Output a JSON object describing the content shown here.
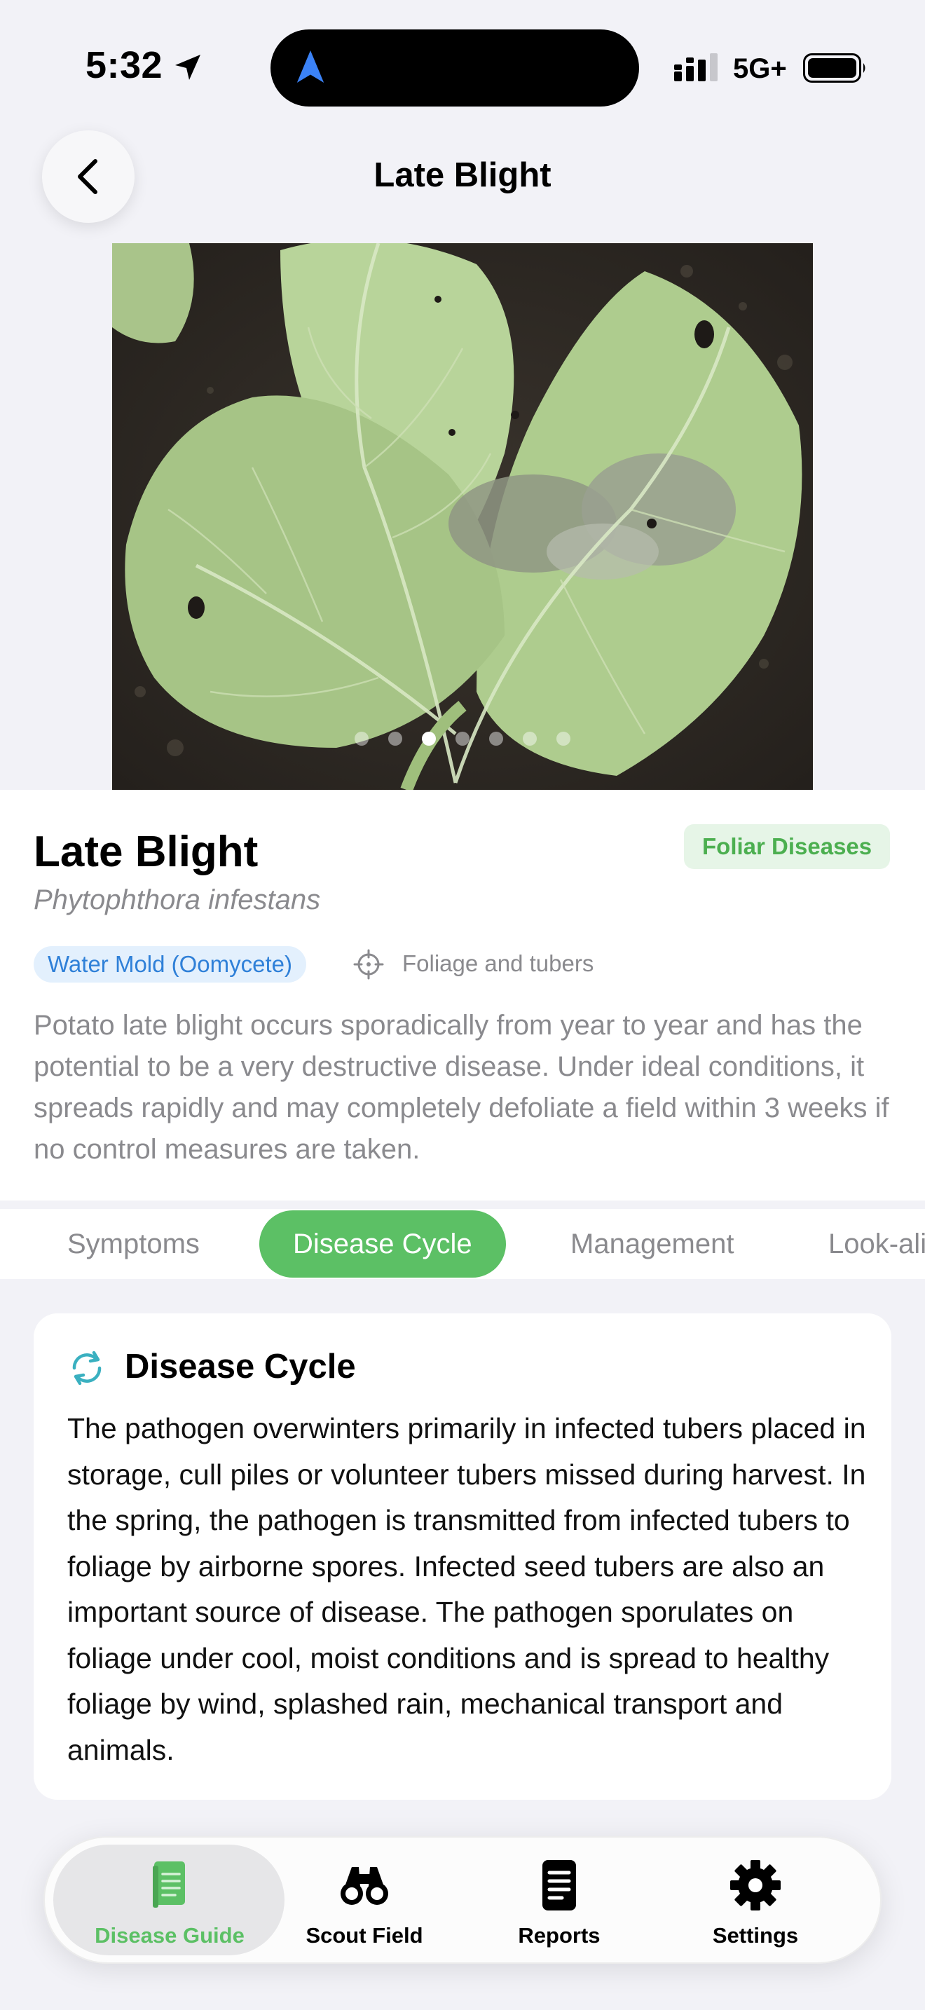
{
  "status_bar": {
    "time": "5:32",
    "network": "5G+",
    "icons": [
      "location-arrow-icon",
      "navigation-icon",
      "signal-icon",
      "battery-icon"
    ]
  },
  "header": {
    "title": "Late Blight",
    "back_icon": "chevron-left-icon"
  },
  "gallery": {
    "image_description": "potato-leaf-photo",
    "slide_count": 7,
    "active_index": 2
  },
  "disease": {
    "name": "Late Blight",
    "category": "Foliar Diseases",
    "scientific_name": "Phytophthora infestans",
    "pathogen_type": "Water Mold (Oomycete)",
    "affected_parts": "Foliage and tubers",
    "summary": "Potato late blight occurs sporadically from year to year and has the potential to be a very destructive disease. Under ideal conditions, it spreads rapidly and may completely defoliate a field within 3 weeks if no control measures are taken."
  },
  "tabs": [
    {
      "label": "Symptoms"
    },
    {
      "label": "Disease Cycle"
    },
    {
      "label": "Management"
    },
    {
      "label": "Look-alikes"
    }
  ],
  "active_tab": "Disease Cycle",
  "cycle_card": {
    "title": "Disease Cycle",
    "icon": "cycle-arrows-icon",
    "body": "The pathogen overwinters primarily in infected tubers placed in storage, cull piles or volunteer tubers missed during harvest. In the spring, the pathogen is transmitted from infected tubers to foliage by airborne spores. Infected seed tubers are also an important source of disease. The pathogen sporulates on foliage under cool, moist conditions and is spread to healthy foliage by wind, splashed rain, mechanical transport and animals."
  },
  "bottom_nav": [
    {
      "label": "Disease Guide",
      "icon": "book-icon",
      "active": true
    },
    {
      "label": "Scout Field",
      "icon": "binoculars-icon",
      "active": false
    },
    {
      "label": "Reports",
      "icon": "document-icon",
      "active": false
    },
    {
      "label": "Settings",
      "icon": "gear-icon",
      "active": false
    }
  ],
  "colors": {
    "accent_green": "#5cc065",
    "badge_blue": "#2f80d8",
    "badge_blue_bg": "#e3f0fd",
    "badge_green_bg": "#e6f5e7",
    "secondary_text": "#8a8a8e",
    "background": "#f2f2f7",
    "cycle_icon": "#3ab0c0"
  }
}
